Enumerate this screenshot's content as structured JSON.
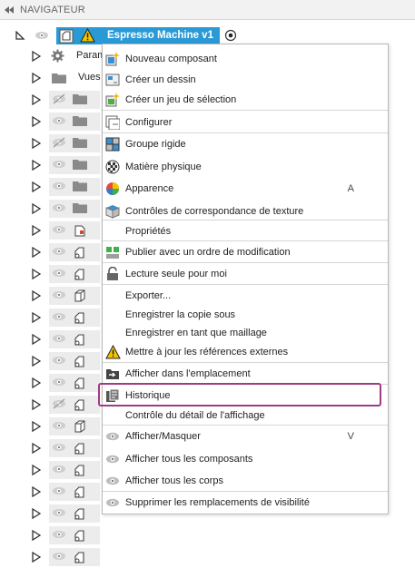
{
  "header": {
    "title": "NAVIGATEUR"
  },
  "root": {
    "name": "Espresso Machine v1"
  },
  "tree_labels": {
    "params": "Param",
    "views": "Vues"
  },
  "menu": {
    "items": [
      {
        "label": "Nouveau composant",
        "icon": "new-component-icon"
      },
      {
        "label": "Créer un dessin",
        "icon": "drawing-icon"
      },
      {
        "label": "Créer un jeu de sélection",
        "icon": "selection-set-icon"
      },
      {
        "label": "Configurer",
        "icon": "configure-icon"
      },
      {
        "label": "Groupe rigide",
        "icon": "rigid-group-icon"
      },
      {
        "label": "Matière physique",
        "icon": "physical-material-icon"
      },
      {
        "label": "Apparence",
        "icon": "appearance-icon",
        "shortcut": "A"
      },
      {
        "label": "Contrôles de correspondance de texture",
        "icon": "texture-map-icon"
      },
      {
        "label": "Propriétés",
        "icon": ""
      },
      {
        "label": "Publier avec un ordre de modification",
        "icon": "publish-icon"
      },
      {
        "label": "Lecture seule pour moi",
        "icon": "lock-icon"
      },
      {
        "label": "Exporter...",
        "icon": ""
      },
      {
        "label": "Enregistrer la copie sous",
        "icon": ""
      },
      {
        "label": "Enregistrer en tant que maillage",
        "icon": ""
      },
      {
        "label": "Mettre à jour les références externes",
        "icon": "warning-icon"
      },
      {
        "label": "Afficher dans l'emplacement",
        "icon": "show-location-icon"
      },
      {
        "label": "Historique",
        "icon": "history-icon"
      },
      {
        "label": "Contrôle du détail de l'affichage",
        "icon": ""
      },
      {
        "label": "Afficher/Masquer",
        "icon": "eye-icon",
        "shortcut": "V"
      },
      {
        "label": "Afficher tous les composants",
        "icon": "eye-icon"
      },
      {
        "label": "Afficher tous les corps",
        "icon": "eye-icon"
      },
      {
        "label": "Supprimer les remplacements de visibilité",
        "icon": "eye-icon"
      }
    ]
  },
  "colors": {
    "selection": "#2a9ad6",
    "highlight": "#a03a84"
  }
}
